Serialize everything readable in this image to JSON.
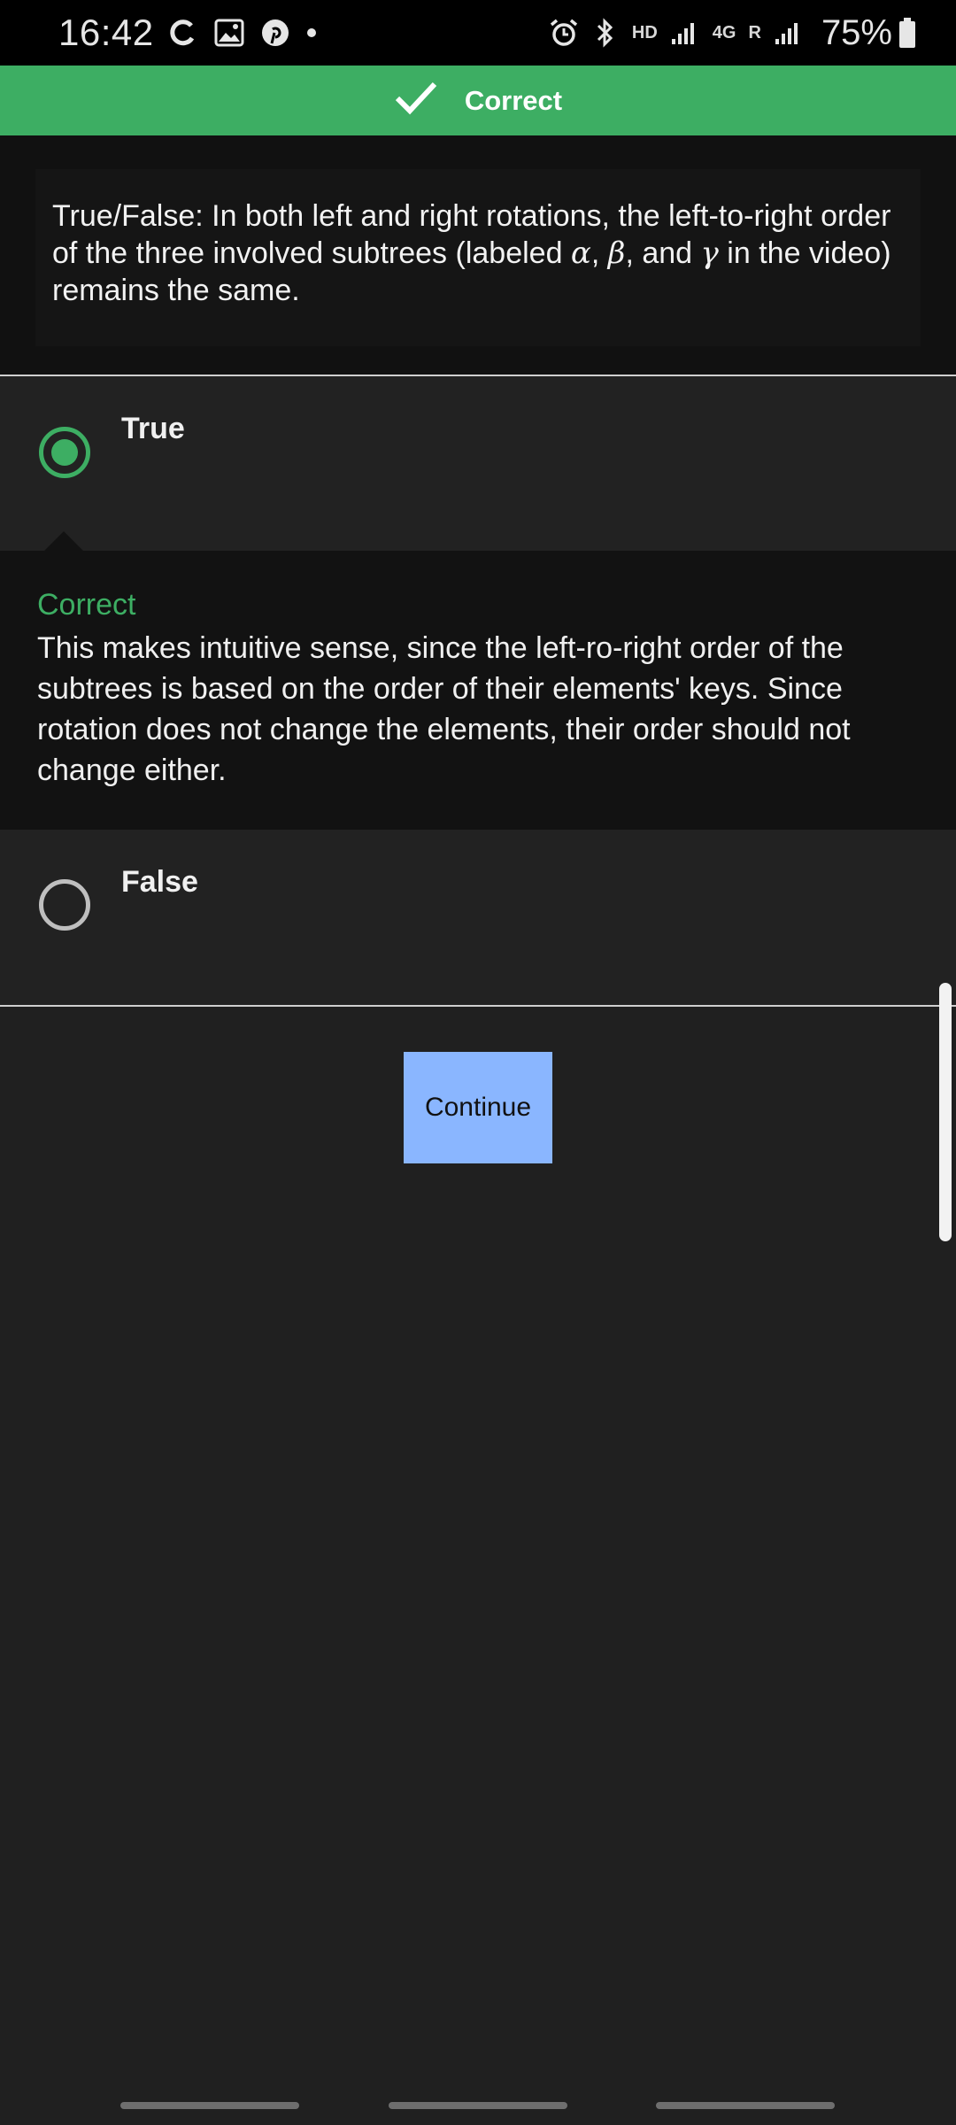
{
  "status_bar": {
    "time": "16:42",
    "network": "HD",
    "network_gen": "4G",
    "roaming": "R",
    "battery": "75%",
    "icons": [
      "sync-icon",
      "gallery-icon",
      "pinterest-icon",
      "dot-icon",
      "alarm-icon",
      "bluetooth-icon",
      "signal-icon",
      "battery-icon"
    ]
  },
  "banner": {
    "label": "Correct",
    "color": "#3dae63",
    "icon": "checkmark-icon"
  },
  "question": {
    "text_before": "True/False: In both left and right rotations, the left-to-right order of the three involved subtrees (labeled ",
    "alpha": "α",
    "sep1": ", ",
    "beta": "β",
    "sep2": ", and ",
    "gamma": "γ",
    "text_after": " in the video) remains the same."
  },
  "options": [
    {
      "label": "True",
      "selected": true
    },
    {
      "label": "False",
      "selected": false
    }
  ],
  "feedback": {
    "title": "Correct",
    "body": "This makes intuitive sense, since the left-ro-right order of the subtrees is based on the order of their elements' keys. Since rotation does not change the elements, their order should not change either."
  },
  "continue_button": {
    "label": "Continue",
    "color": "#8ab6ff"
  }
}
